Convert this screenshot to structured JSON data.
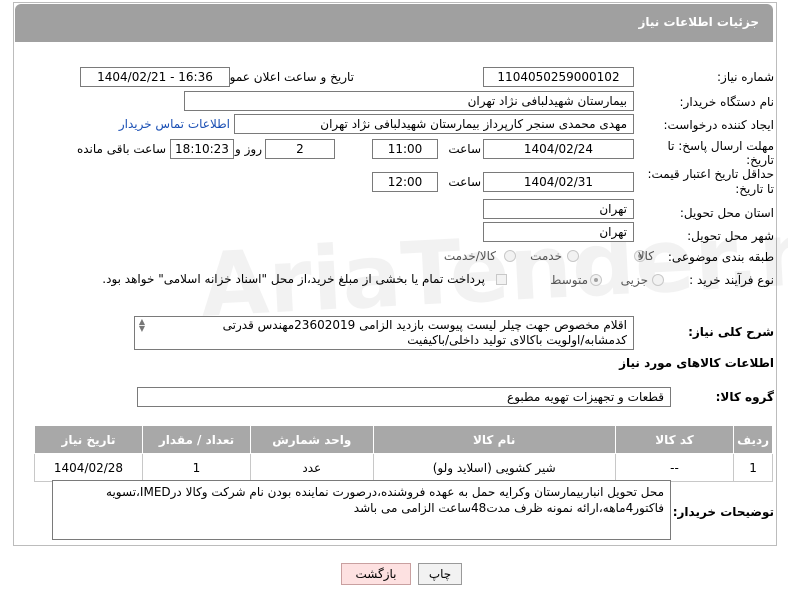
{
  "header": {
    "title": "جزئیات اطلاعات نیاز"
  },
  "fields": {
    "need_number_label": "شماره نیاز:",
    "need_number": "1104050259000102",
    "announce_label": "تاریخ و ساعت اعلان عمومی:",
    "announce_value": "1404/02/21 - 16:36",
    "buyer_org_label": "نام دستگاه خریدار:",
    "buyer_org": "بیمارستان شهیدلبافی نژاد تهران",
    "requester_label": "ایجاد کننده درخواست:",
    "requester": "مهدی محمدی سنجر کارپرداز بیمارستان شهیدلبافی نژاد تهران",
    "buyer_contact_link": "اطلاعات تماس خریدار",
    "deadline_label_1": "مهلت ارسال پاسخ: تا",
    "deadline_label_2": "تاریخ:",
    "deadline_date": "1404/02/24",
    "time_label": "ساعت",
    "deadline_time": "11:00",
    "deadline_days": "2",
    "days_label": "روز و",
    "remaining_time": "18:10:23",
    "remaining_label": "ساعت باقی مانده",
    "price_valid_label_1": "حداقل تاریخ اعتبار قیمت:",
    "price_valid_label_2": "تا تاریخ:",
    "price_valid_date": "1404/02/31",
    "price_valid_time": "12:00",
    "province_label": "استان محل تحویل:",
    "province": "تهران",
    "city_label": "شهر محل تحویل:",
    "city": "تهران",
    "category_label": "طبقه بندی موضوعی:",
    "category_options": [
      "کالا",
      "خدمت",
      "کالا/خدمت"
    ],
    "process_label": "نوع فرآیند خرید :",
    "process_options": [
      "جزیی",
      "متوسط"
    ],
    "payment_note": "پرداخت تمام یا بخشی از مبلغ خرید،از محل \"اسناد خزانه اسلامی\" خواهد بود.",
    "description_label": "شرح کلی نیاز:",
    "description_line1": "اقلام مخصوص جهت چیلر لیست پیوست بازدید الزامی 23602019مهندس قدرتی",
    "description_line2": "کدمشابه/اولویت باکالای تولید داخلی/باکیفیت",
    "goods_info_title": "اطلاعات کالاهای مورد نیاز",
    "goods_group_label": "گروه کالا:",
    "goods_group": "قطعات و تجهیزات تهویه مطبوع",
    "buyer_notes_label": "توضیحات خریدار:",
    "buyer_notes_line1": "محل تحویل انباربیمارستان وکرایه حمل به عهده فروشنده،درصورت نماینده بودن نام شرکت وکالا درIMED،تسویه",
    "buyer_notes_line2": "فاکتور4ماهه،ارائه نمونه ظرف مدت48ساعت الزامی می باشد"
  },
  "table": {
    "headers": [
      "ردیف",
      "کد کالا",
      "نام کالا",
      "واحد شمارش",
      "تعداد / مقدار",
      "تاریخ نیاز"
    ],
    "rows": [
      [
        "1",
        "--",
        "شیر کشویی (اسلاید ولو)",
        "عدد",
        "1",
        "1404/02/28"
      ]
    ]
  },
  "buttons": {
    "print": "چاپ",
    "back": "بازگشت"
  },
  "watermark": "AriaTender.net"
}
